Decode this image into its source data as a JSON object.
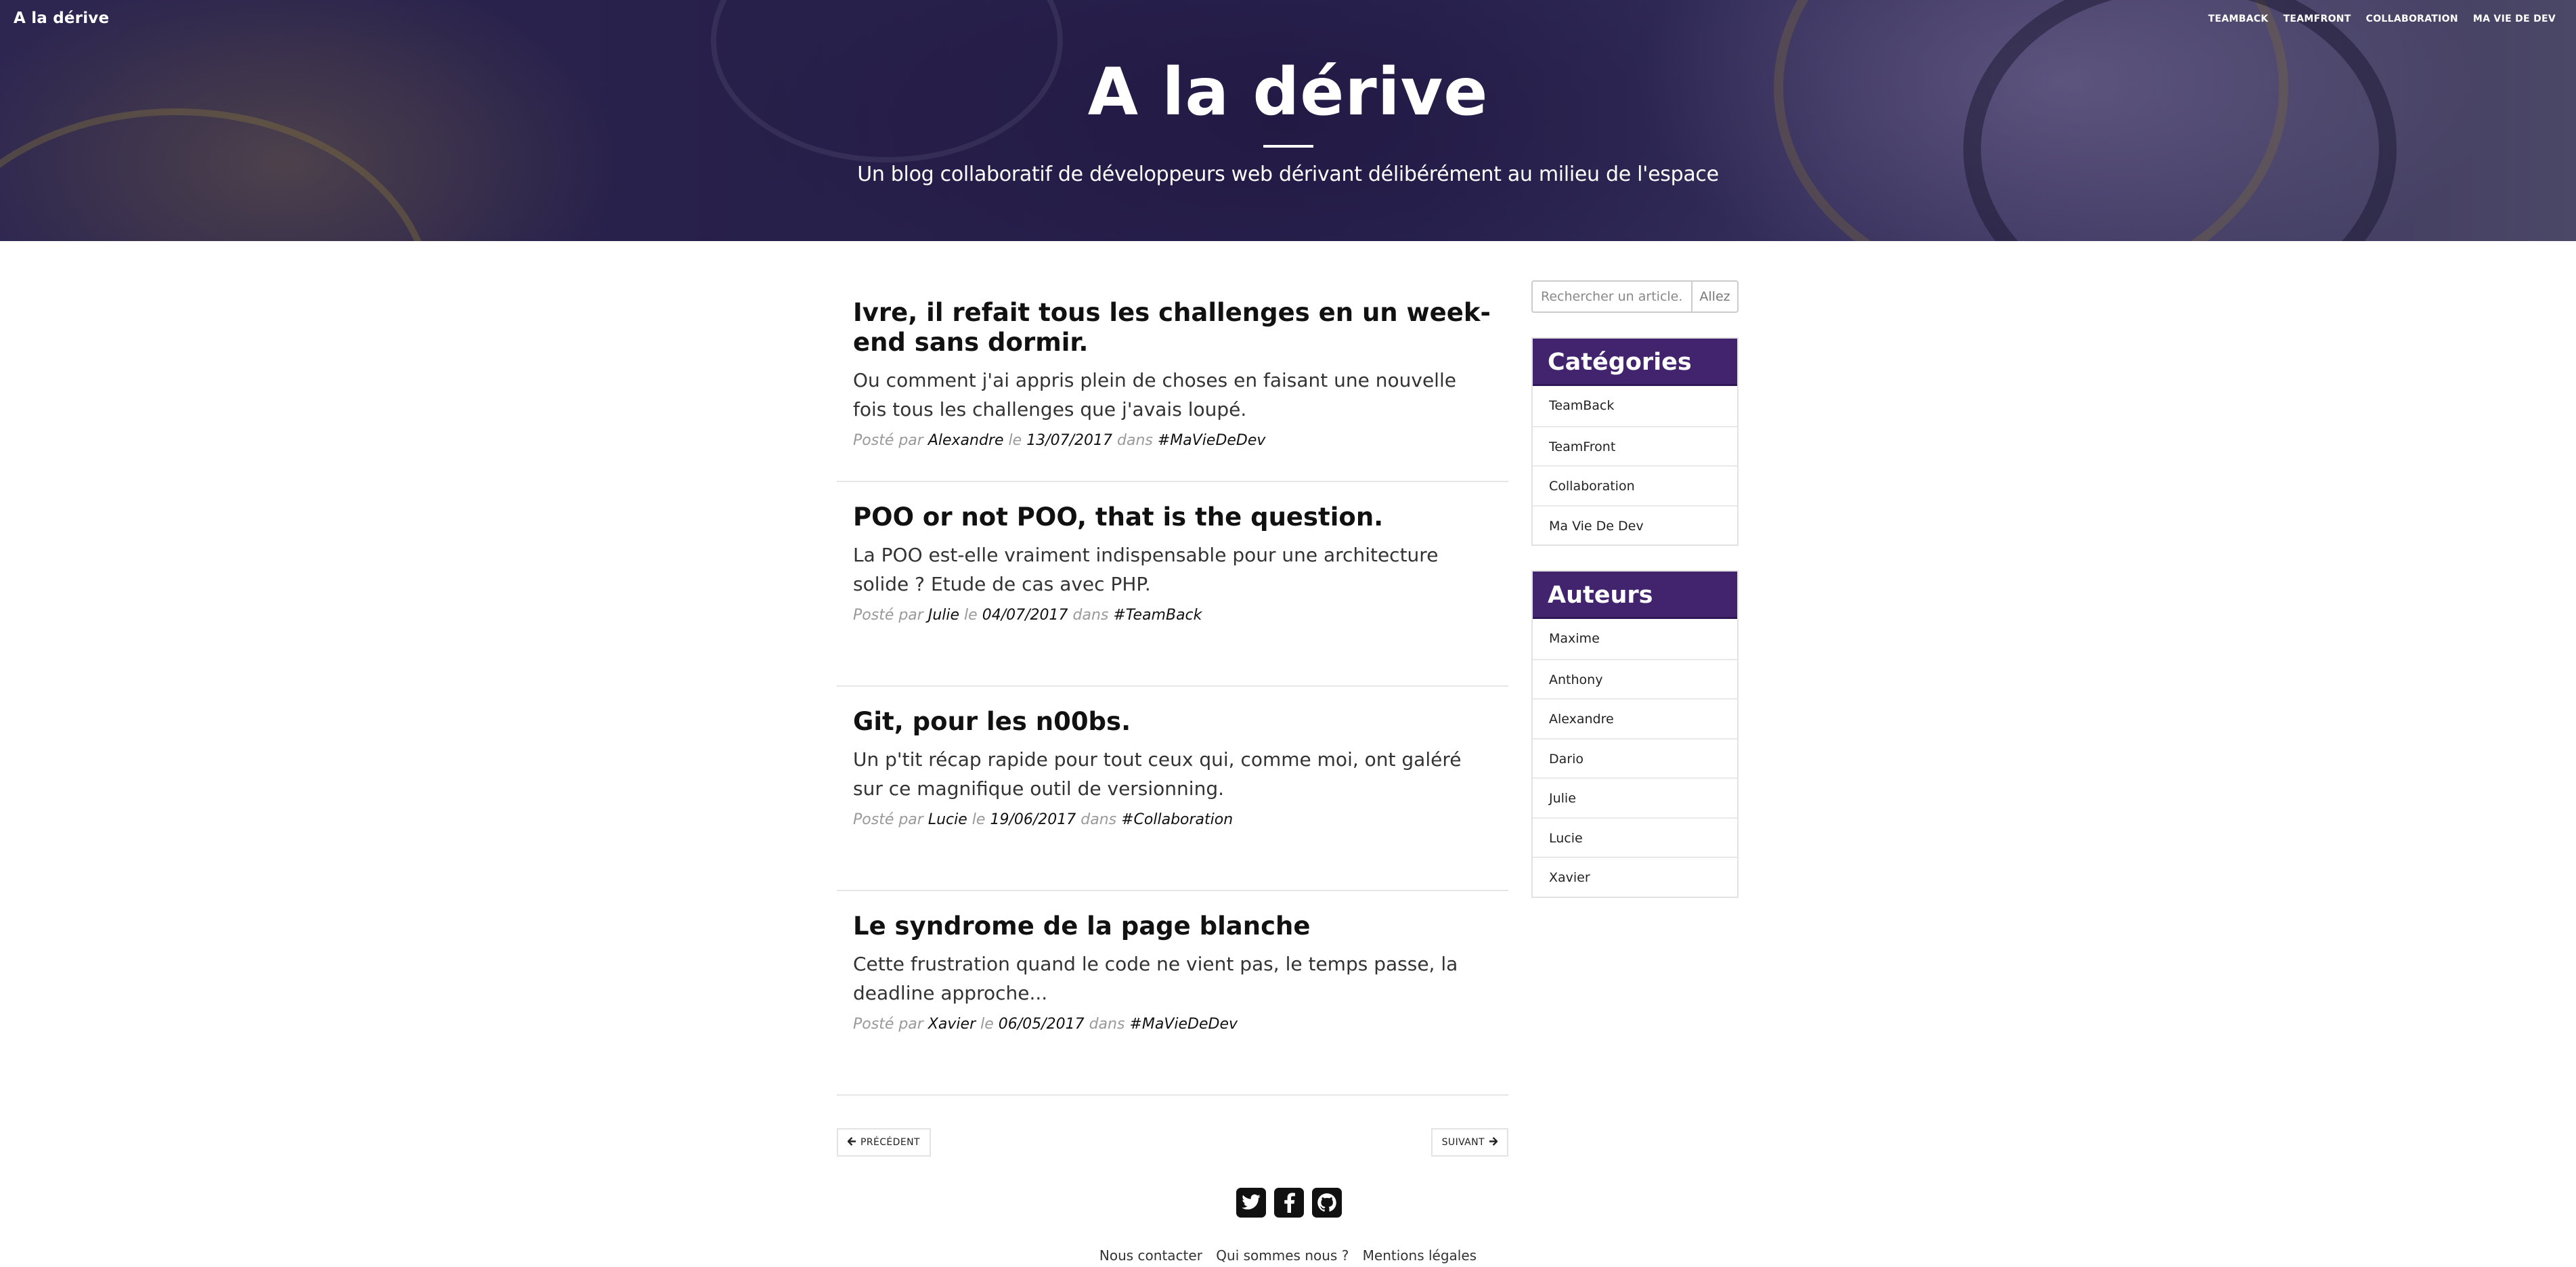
{
  "nav": {
    "brand": "A la dérive",
    "links": [
      "TEAMBACK",
      "TEAMFRONT",
      "COLLABORATION",
      "MA VIE DE DEV"
    ]
  },
  "hero": {
    "title": "A la dérive",
    "subtitle": "Un blog collaboratif de développeurs web dérivant délibérément au milieu de l'espace"
  },
  "posts": [
    {
      "title": "Ivre, il refait tous les challenges en un week-end sans dormir.",
      "excerpt": "Ou comment j'ai appris plein de choses en faisant une nouvelle fois tous les challenges que j'avais loupé.",
      "posted_by_label": "Posté par",
      "author": "Alexandre",
      "date_label": "le",
      "date": "13/07/2017",
      "in_label": "dans",
      "category": "#MaVieDeDev"
    },
    {
      "title": "POO or not POO, that is the question.",
      "excerpt": "La POO est-elle vraiment indispensable pour une architecture solide ? Etude de cas avec PHP.",
      "posted_by_label": "Posté par",
      "author": "Julie",
      "date_label": "le",
      "date": "04/07/2017",
      "in_label": "dans",
      "category": "#TeamBack"
    },
    {
      "title": "Git, pour les n00bs.",
      "excerpt": "Un p'tit récap rapide pour tout ceux qui, comme moi, ont galéré sur ce magnifique outil de versionning.",
      "posted_by_label": "Posté par",
      "author": "Lucie",
      "date_label": "le",
      "date": "19/06/2017",
      "in_label": "dans",
      "category": "#Collaboration"
    },
    {
      "title": "Le syndrome de la page blanche",
      "excerpt": "Cette frustration quand le code ne vient pas, le temps passe, la deadline approche...",
      "posted_by_label": "Posté par",
      "author": "Xavier",
      "date_label": "le",
      "date": "06/05/2017",
      "in_label": "dans",
      "category": "#MaVieDeDev"
    }
  ],
  "pager": {
    "prev_label": "PRÉCÉDENT",
    "next_label": "SUIVANT",
    "prev_icon": "arrow-left-icon",
    "next_icon": "arrow-right-icon"
  },
  "search": {
    "placeholder": "Rechercher un article...",
    "button_label": "Allez"
  },
  "categories": {
    "title": "Catégories",
    "items": [
      "TeamBack",
      "TeamFront",
      "Collaboration",
      "Ma Vie De Dev"
    ]
  },
  "authors": {
    "title": "Auteurs",
    "items": [
      "Maxime",
      "Anthony",
      "Alexandre",
      "Dario",
      "Julie",
      "Lucie",
      "Xavier"
    ]
  },
  "footer": {
    "social": [
      "twitter-icon",
      "facebook-icon",
      "github-icon"
    ],
    "links": [
      "Nous contacter",
      "Qui sommes nous ?",
      "Mentions légales"
    ]
  },
  "colors": {
    "accent": "#41236e",
    "hero_bg": "#2a2452"
  }
}
